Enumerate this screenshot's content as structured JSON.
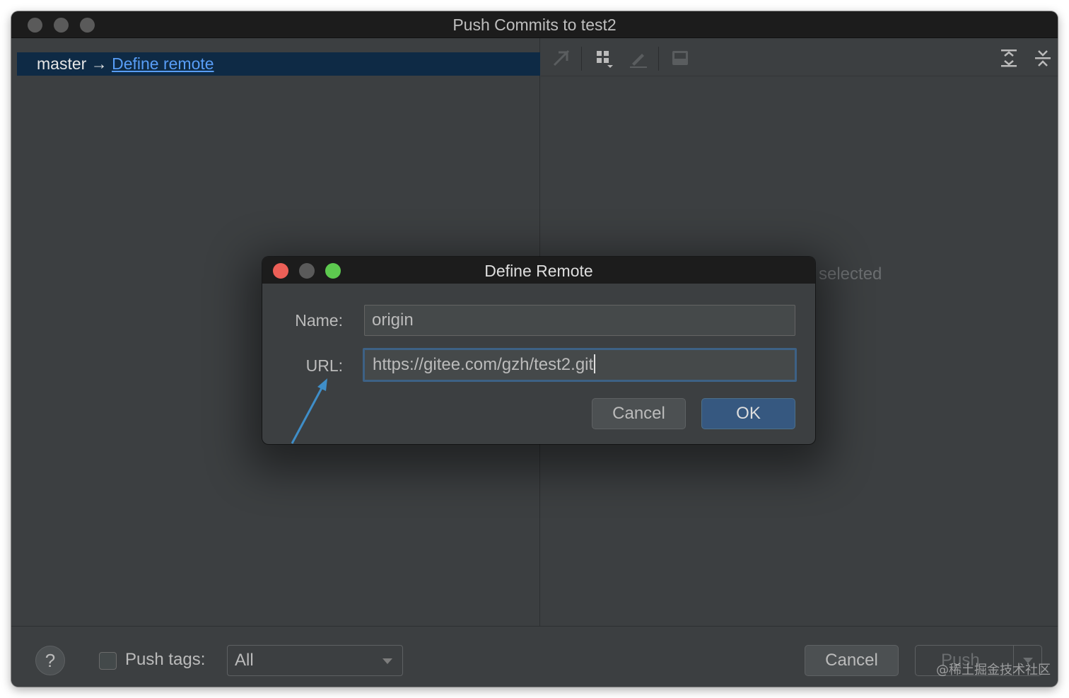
{
  "window": {
    "title": "Push Commits to test2"
  },
  "left_pane": {
    "branch": "master",
    "arrow": "→",
    "define_remote_link": "Define remote"
  },
  "right_pane": {
    "toolbar_icons": [
      "expand-collapse-icon",
      "group-by-icon",
      "edit-source-icon",
      "show-diff-icon",
      "expand-all-icon",
      "collapse-all-icon"
    ],
    "empty_text": "selected"
  },
  "bottom_bar": {
    "help_label": "?",
    "push_tags_label": "Push tags:",
    "push_tags_checked": false,
    "push_tags_select": "All",
    "cancel_label": "Cancel",
    "push_label": "Push",
    "watermark": "@稀土掘金技术社区"
  },
  "dialog": {
    "title": "Define Remote",
    "name_label": "Name:",
    "name_value": "origin",
    "url_label": "URL:",
    "url_value": "https://gitee.com/gzh/test2.git",
    "cancel_label": "Cancel",
    "ok_label": "OK"
  },
  "colors": {
    "close": "#ec5f57",
    "minimize": "#5a5a5a",
    "maximize": "#5dc94f",
    "link": "#589df6",
    "ok_button": "#365880",
    "annotation_arrow": "#3f8ec8"
  }
}
